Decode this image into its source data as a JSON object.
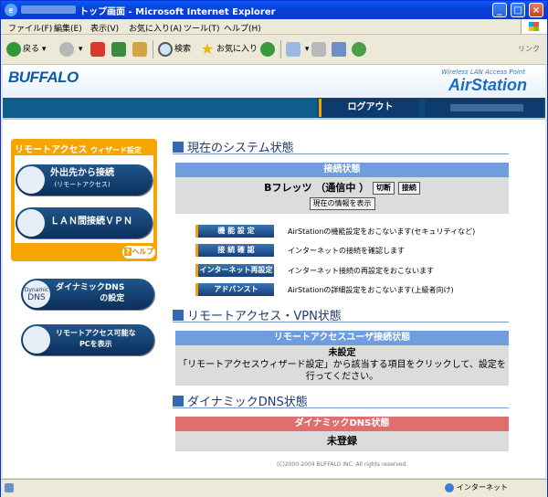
{
  "window": {
    "title": "トップ画面 - Microsoft Internet Explorer",
    "controls": {
      "minimize": "_",
      "maximize": "□",
      "close": "×"
    }
  },
  "menu": [
    "ファイル(F)",
    "編集(E)",
    "表示(V)",
    "お気に入り(A)",
    "ツール(T)",
    "ヘルプ(H)"
  ],
  "toolbar": {
    "back": "戻る",
    "search": "検索",
    "favorites": "お気に入り",
    "links": "リンク"
  },
  "header": {
    "logo": "BUFFALO",
    "product_sub": "Wireless LAN Access Point",
    "product": "AirStation",
    "logout": "ログアウト"
  },
  "sidebar": {
    "remote_title": "リモートアクセス",
    "remote_title_small": "ウィザード設定",
    "outside_connect": "外出先から接続",
    "outside_connect_sub": "(リモートアクセス)",
    "lan_vpn": "ＬＡＮ間接続ＶＰＮ",
    "help": "ヘルプ",
    "dynamic_icon_1": "Dynamic",
    "dynamic_icon_2": "DNS",
    "ddns_1": "ダイナミックDNS",
    "ddns_2": "の設定",
    "show_pc_1": "リモートアクセス可能な",
    "show_pc_2": "PCを表示"
  },
  "system": {
    "title": "現在のシステム状態",
    "conn_header": "接続状態",
    "conn_name": "Bフレッツ",
    "conn_state": "（通信中 ）",
    "disconnect": "切断",
    "connect": "接続",
    "show_info": "現在の情報を表示",
    "functions": [
      {
        "label": "機 能 設 定",
        "desc": "AirStationの機能設定をおこないます(セキュリティなど)"
      },
      {
        "label": "接 続 確 認",
        "desc": "インターネットの接続を確認します"
      },
      {
        "label": "インターネット再設定",
        "desc": "インターネット接続の再設定をおこないます"
      },
      {
        "label": "アドバンスト",
        "desc": "AirStationの詳細設定をおこないます(上級者向け)"
      }
    ]
  },
  "remote": {
    "title": "リモートアクセス・VPN状態",
    "header": "リモートアクセスユーザ接続状態",
    "status": "未設定",
    "message_1": "「リモートアクセスウィザード設定」から該当する項目をクリックして、設定を",
    "message_2": "行ってください。"
  },
  "ddns": {
    "title": "ダイナミックDNS状態",
    "header": "ダイナミックDNS状態",
    "status": "未登録"
  },
  "footer": {
    "copyright": "(C)2000-2004 BUFFALO INC. All rights reserved."
  },
  "statusbar": {
    "zone": "インターネット"
  },
  "colors": {
    "accent_orange": "#f5a400",
    "header_blue": "#6e9de0",
    "ddns_red": "#e06e6e",
    "navy": "#0e4a78"
  }
}
